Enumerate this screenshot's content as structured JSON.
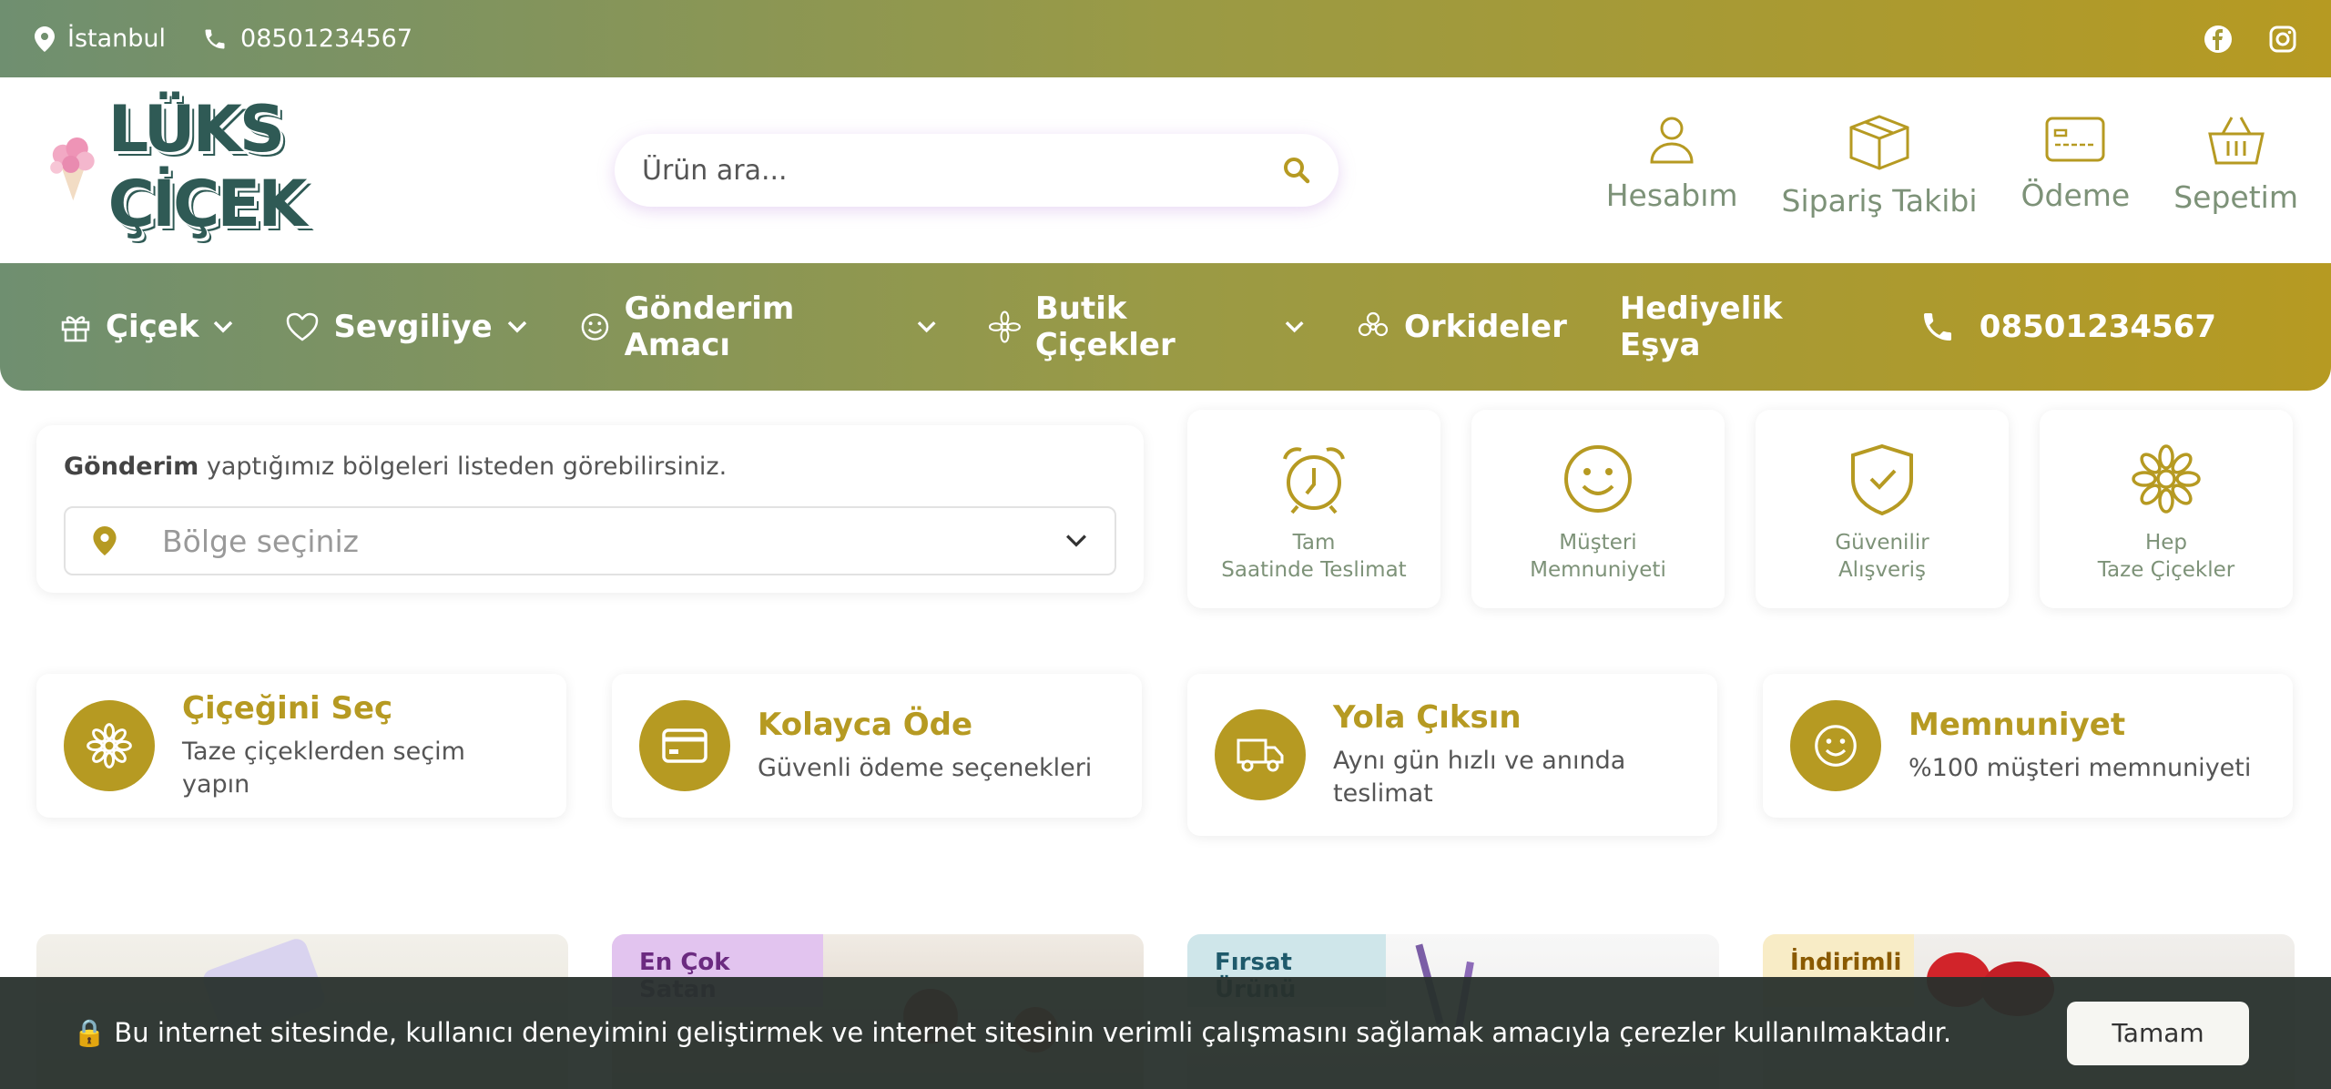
{
  "topbar": {
    "city": "İstanbul",
    "phone": "08501234567",
    "socials": [
      "facebook-icon",
      "instagram-icon"
    ]
  },
  "header": {
    "logo_text": "LÜKS ÇİÇEK",
    "search_placeholder": "Ürün ara...",
    "links": [
      {
        "label": "Hesabım",
        "icon": "user-icon"
      },
      {
        "label": "Sipariş Takibi",
        "icon": "box-icon"
      },
      {
        "label": "Ödeme",
        "icon": "card-icon"
      },
      {
        "label": "Sepetim",
        "icon": "basket-icon"
      }
    ]
  },
  "nav": {
    "items": [
      {
        "label": "Çiçek",
        "icon": "gift-icon",
        "dropdown": true
      },
      {
        "label": "Sevgiliye",
        "icon": "heart-icon",
        "dropdown": true
      },
      {
        "label": "Gönderim Amacı",
        "icon": "smile-icon",
        "dropdown": true
      },
      {
        "label": "Butik Çiçekler",
        "icon": "flower-icon",
        "dropdown": true
      },
      {
        "label": "Orkideler",
        "icon": "orchid-icon",
        "dropdown": false
      },
      {
        "label": "Hediyelik Eşya",
        "icon": "",
        "dropdown": false
      }
    ],
    "phone": "08501234567"
  },
  "region": {
    "bold": "Gönderim",
    "text": " yaptığımız bölgeleri listeden görebilirsiniz.",
    "select_placeholder": "Bölge seçiniz"
  },
  "features": [
    {
      "line1": "Tam",
      "line2": "Saatinde Teslimat",
      "icon": "alarm-clock-icon"
    },
    {
      "line1": "Müşteri",
      "line2": "Memnuniyeti",
      "icon": "smile-icon"
    },
    {
      "line1": "Güvenilir",
      "line2": "Alışveriş",
      "icon": "shield-check-icon"
    },
    {
      "line1": "Hep",
      "line2": "Taze Çiçekler",
      "icon": "daisy-icon"
    }
  ],
  "steps": [
    {
      "title": "Çiçeğini Seç",
      "subtitle": "Taze çiçeklerden seçim yapın",
      "icon": "daisy-icon"
    },
    {
      "title": "Kolayca Öde",
      "subtitle": "Güvenli ödeme seçenekleri",
      "icon": "credit-card-icon"
    },
    {
      "title": "Yola Çıksın",
      "subtitle": "Aynı gün hızlı ve anında teslimat",
      "icon": "truck-icon"
    },
    {
      "title": "Memnuniyet",
      "subtitle": "%100 müşteri memnuniyeti",
      "icon": "smile-icon"
    }
  ],
  "products": [
    {
      "badge": ""
    },
    {
      "badge": "En Çok Satan"
    },
    {
      "badge": "Fırsat Ürünü"
    },
    {
      "badge": "İndirimli"
    }
  ],
  "cookie": {
    "message": "🔒 Bu internet sitesinde, kullanıcı deneyimini geliştirmek ve internet sitesinin verimli çalışmasını sağlamak amacıyla çerezler kullanılmaktadır.",
    "button": "Tamam"
  },
  "colors": {
    "accent": "#b69a22",
    "green": "#6f8f70",
    "text_green": "#7d9278"
  }
}
